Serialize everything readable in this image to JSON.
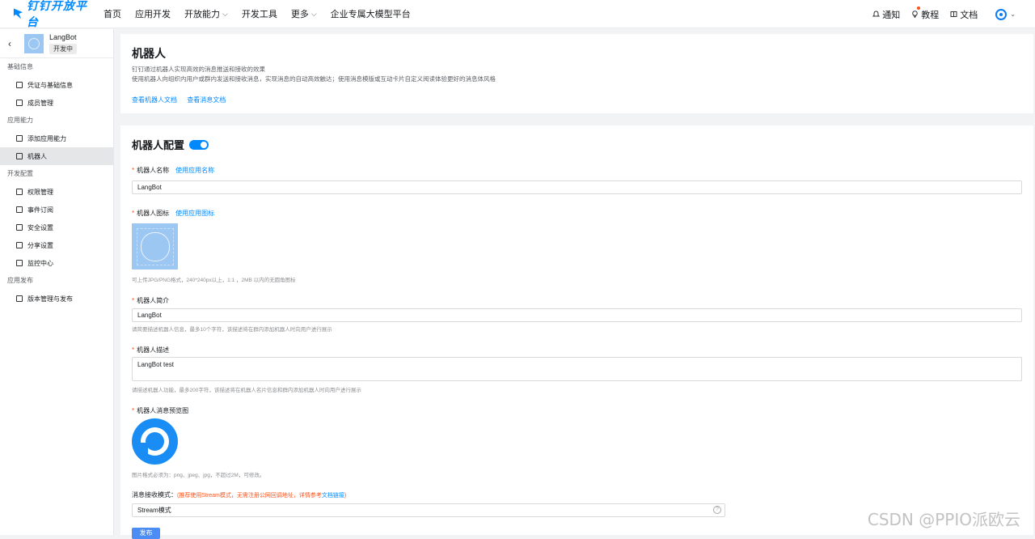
{
  "nav": {
    "logo": "钉钉开放平台",
    "items": [
      {
        "label": "首页",
        "chevron": false
      },
      {
        "label": "应用开发",
        "chevron": false
      },
      {
        "label": "开放能力",
        "chevron": true
      },
      {
        "label": "开发工具",
        "chevron": false
      },
      {
        "label": "更多",
        "chevron": true
      },
      {
        "label": "企业专属大模型平台",
        "chevron": false
      }
    ],
    "right": {
      "notify": "通知",
      "tutorial": "教程",
      "docs": "文档"
    }
  },
  "sidebar": {
    "app_name": "LangBot",
    "app_status": "开发中",
    "groups": [
      {
        "title": "基础信息",
        "items": [
          "凭证与基础信息",
          "成员管理"
        ]
      },
      {
        "title": "应用能力",
        "items": [
          "添加应用能力",
          "机器人"
        ]
      },
      {
        "title": "开发配置",
        "items": [
          "权限管理",
          "事件订阅",
          "安全设置",
          "分享设置",
          "监控中心"
        ]
      },
      {
        "title": "应用发布",
        "items": [
          "版本管理与发布"
        ]
      }
    ],
    "active": "机器人"
  },
  "intro": {
    "title": "机器人",
    "desc1": "钉钉通过机器人实现高效的消息推送和接收的效果",
    "desc2": "使用机器人向组织内用户或群内发送和接收消息，实现消息的自动高效触达；使用消息模版或互动卡片自定义阅读体验更好的消息体风格",
    "link1": "查看机器人文档",
    "link2": "查看消息文档"
  },
  "config": {
    "title": "机器人配置",
    "enabled": true,
    "name_label": "机器人名称",
    "name_link": "使用应用名称",
    "name_value": "LangBot",
    "icon_label": "机器人图标",
    "icon_link": "使用应用图标",
    "icon_hint": "可上传JPG/PNG格式，240*240px以上，1:1 ，2MB 以内的无圆角图标",
    "brief_label": "机器人简介",
    "brief_value": "LangBot",
    "brief_hint": "请简要描述机器人信息，最多10个字符，该描述将在群内添加机器人时向用户进行展示",
    "desc_label": "机器人描述",
    "desc_value": "LangBot test",
    "desc_hint": "请描述机器人功能，最多200字符，该描述将在机器人名片信息和群内添加机器人时向用户进行展示",
    "preview_label": "机器人消息预览图",
    "preview_hint": "图片格式必须为：png、jpeg、jpg，不超过2M，可修改。",
    "mode_label": "消息接收模式：",
    "mode_note_prefix": "(推荐使用Stream模式，无需注册公网回调地址，详情参考",
    "mode_note_link": "文档链接",
    "mode_note_suffix": ")",
    "mode_value": "Stream模式",
    "save": "发布"
  },
  "watermark": "CSDN @PPIO派欧云"
}
